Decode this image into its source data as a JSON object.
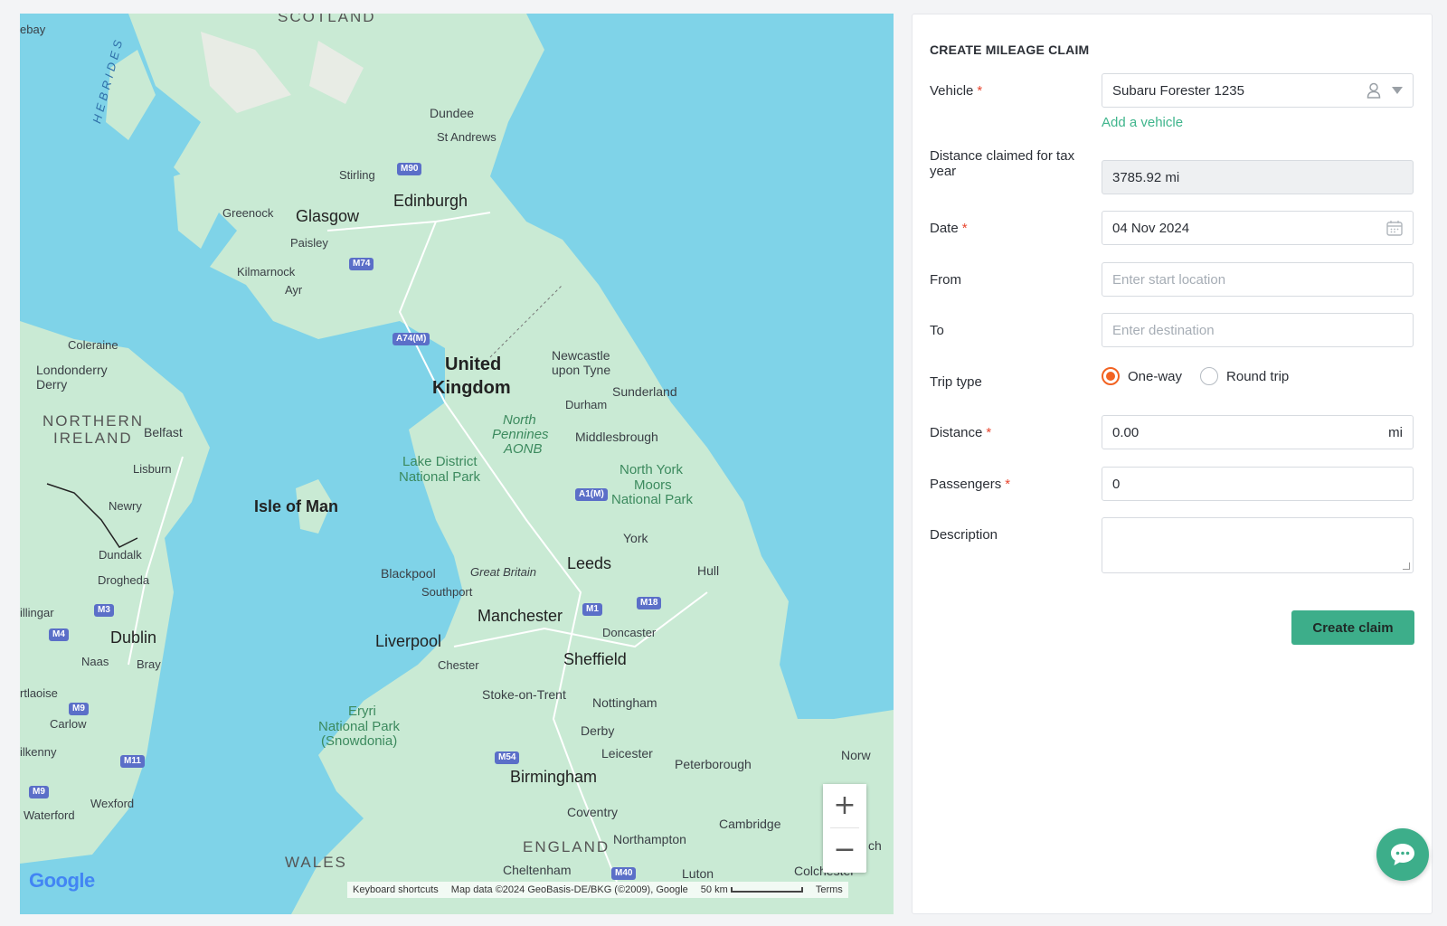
{
  "map": {
    "labels": {
      "scotland": "SCOTLAND",
      "hebrides": "HEBRIDES",
      "ebay": "ebay",
      "dundee": "Dundee",
      "st_andrews": "St Andrews",
      "stirling": "Stirling",
      "edinburgh": "Edinburgh",
      "greenock": "Greenock",
      "glasgow": "Glasgow",
      "paisley": "Paisley",
      "kilmarnock": "Kilmarnock",
      "ayr": "Ayr",
      "coleraine": "Coleraine",
      "londonderry": "Londonderry",
      "derry": "Derry",
      "northern_ireland_1": "NORTHERN",
      "northern_ireland_2": "IRELAND",
      "belfast": "Belfast",
      "lisburn": "Lisburn",
      "newry": "Newry",
      "dundalk": "Dundalk",
      "drogheda": "Drogheda",
      "mullingar": "illingar",
      "dublin": "Dublin",
      "naas": "Naas",
      "bray": "Bray",
      "portlaoise": "rtlaoise",
      "carlow": "Carlow",
      "kilkenny": "ilkenny",
      "wexford": "Wexford",
      "waterford": "Waterford",
      "uk_1": "United",
      "uk_2": "Kingdom",
      "newcastle_1": "Newcastle",
      "newcastle_2": "upon Tyne",
      "sunderland": "Sunderland",
      "durham": "Durham",
      "north_pennines_1": "North",
      "north_pennines_2": "Pennines",
      "north_pennines_3": "AONB",
      "middlesbrough": "Middlesbrough",
      "lake_district_1": "Lake District",
      "lake_district_2": "National Park",
      "north_york_1": "North York",
      "north_york_2": "Moors",
      "north_york_3": "National Park",
      "isle_of_man": "Isle of Man",
      "york": "York",
      "blackpool": "Blackpool",
      "great_britain": "Great Britain",
      "leeds": "Leeds",
      "hull": "Hull",
      "southport": "Southport",
      "manchester": "Manchester",
      "doncaster": "Doncaster",
      "liverpool": "Liverpool",
      "sheffield": "Sheffield",
      "chester": "Chester",
      "stoke": "Stoke-on-Trent",
      "nottingham": "Nottingham",
      "eryri_1": "Eryri",
      "eryri_2": "National Park",
      "eryri_3": "(Snowdonia)",
      "derby": "Derby",
      "leicester": "Leicester",
      "peterborough": "Peterborough",
      "norwich": "Norw",
      "birmingham": "Birmingham",
      "coventry": "Coventry",
      "cambridge": "Cambridge",
      "wales": "WALES",
      "england": "ENGLAND",
      "northampton": "Northampton",
      "cheltenham": "Cheltenham",
      "luton": "Luton",
      "colchester": "Colchester",
      "ch": "ch"
    },
    "shields": {
      "m90": "M90",
      "m74": "M74",
      "a74m": "A74(M)",
      "a1m": "A1(M)",
      "m1": "M1",
      "m18": "M18",
      "m3": "M3",
      "m4": "M4",
      "m9a": "M9",
      "m11": "M11",
      "m9b": "M9",
      "m54": "M54",
      "m40": "M40"
    },
    "zoom_in": "+",
    "zoom_out": "−",
    "logo": "Google",
    "attribution": {
      "shortcuts": "Keyboard shortcuts",
      "data": "Map data ©2024 GeoBasis-DE/BKG (©2009), Google",
      "scale": "50 km",
      "terms": "Terms"
    }
  },
  "form": {
    "title": "CREATE MILEAGE CLAIM",
    "vehicle": {
      "label": "Vehicle",
      "required": "*",
      "value": "Subaru Forester 1235"
    },
    "add_vehicle": "Add a vehicle",
    "distance_tax": {
      "label": "Distance claimed for tax year",
      "value": "3785.92 mi"
    },
    "date": {
      "label": "Date",
      "required": "*",
      "value": "04 Nov 2024"
    },
    "from": {
      "label": "From",
      "placeholder": "Enter start location"
    },
    "to": {
      "label": "To",
      "placeholder": "Enter destination"
    },
    "trip_type": {
      "label": "Trip type",
      "options": [
        "One-way",
        "Round trip"
      ],
      "selected": "One-way"
    },
    "distance": {
      "label": "Distance",
      "required": "*",
      "value": "0.00",
      "unit": "mi"
    },
    "passengers": {
      "label": "Passengers",
      "required": "*",
      "value": "0"
    },
    "description": {
      "label": "Description",
      "value": ""
    },
    "submit": "Create claim"
  },
  "colors": {
    "accent_green": "#3dae8a",
    "radio_orange": "#f26322",
    "required_red": "#e8462f",
    "water": "#7fd3e8",
    "land": "#cdebd5"
  }
}
